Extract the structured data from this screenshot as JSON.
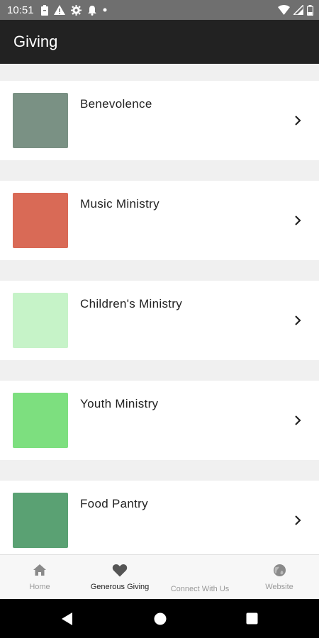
{
  "status_bar": {
    "time": "10:51",
    "left_icons": [
      "battery-saver-icon",
      "warning-icon",
      "settings-icon",
      "notification-bell-icon",
      "dot-icon"
    ],
    "right_icons": [
      "wifi-icon",
      "signal-icon",
      "battery-icon"
    ]
  },
  "app_bar": {
    "title": "Giving"
  },
  "funds": [
    {
      "name": "Benevolence",
      "color": "#7a9184"
    },
    {
      "name": "Music Ministry",
      "color": "#d96a56"
    },
    {
      "name": "Children's Ministry",
      "color": "#c6f3c8"
    },
    {
      "name": "Youth Ministry",
      "color": "#7ddf7f"
    },
    {
      "name": "Food Pantry",
      "color": "#5aa173"
    }
  ],
  "bottom_nav": {
    "items": [
      {
        "label": "Home",
        "icon": "home-icon",
        "active": false
      },
      {
        "label": "Generous Giving",
        "icon": "heart-icon",
        "active": true
      },
      {
        "label": "Connect With Us",
        "icon": "",
        "active": false
      },
      {
        "label": "Website",
        "icon": "globe-icon",
        "active": false
      }
    ]
  },
  "system_nav": [
    "back-icon",
    "home-circle-icon",
    "recents-icon"
  ],
  "colors": {
    "app_bar": "#222222",
    "background": "#f0f0f0",
    "status_bar": "#6f6f6f"
  }
}
